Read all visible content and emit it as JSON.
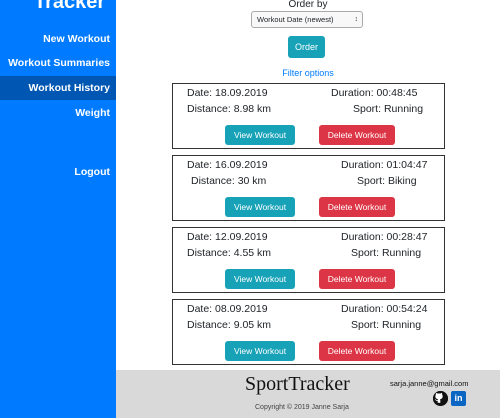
{
  "sidebar": {
    "brand": "Tracker",
    "items": [
      {
        "label": "New Workout"
      },
      {
        "label": "Workout Summaries"
      },
      {
        "label": "Workout History"
      },
      {
        "label": "Weight"
      },
      {
        "label": "Logout"
      }
    ],
    "active_color": "#0056b3",
    "bg_color": "#007bff"
  },
  "controls": {
    "order_label": "Order by",
    "order_select_value": "Workout Date (newest)",
    "order_button": "Order",
    "filter_link": "Filter options"
  },
  "labels": {
    "date": "Date:",
    "duration": "Duration:",
    "distance": "Distance:",
    "sport": "Sport:",
    "view": "View Workout",
    "delete": "Delete Workout"
  },
  "workouts": [
    {
      "date": "18.09.2019",
      "duration": "00:48:45",
      "distance": "8.98 km",
      "sport": "Running"
    },
    {
      "date": "16.09.2019",
      "duration": "01:04:47",
      "distance": "30 km",
      "sport": "Biking"
    },
    {
      "date": "12.09.2019",
      "duration": "00:28:47",
      "distance": "4.55 km",
      "sport": "Running"
    },
    {
      "date": "08.09.2019",
      "duration": "00:54:24",
      "distance": "9.05 km",
      "sport": "Running"
    }
  ],
  "footer": {
    "brand": "SportTracker",
    "copyright": "Copyright © 2019 Janne Sarja",
    "email": "sarja.janne@gmail.com",
    "github_icon": "github-icon",
    "linkedin_icon": "linkedin-icon",
    "linkedin_text": "in"
  }
}
